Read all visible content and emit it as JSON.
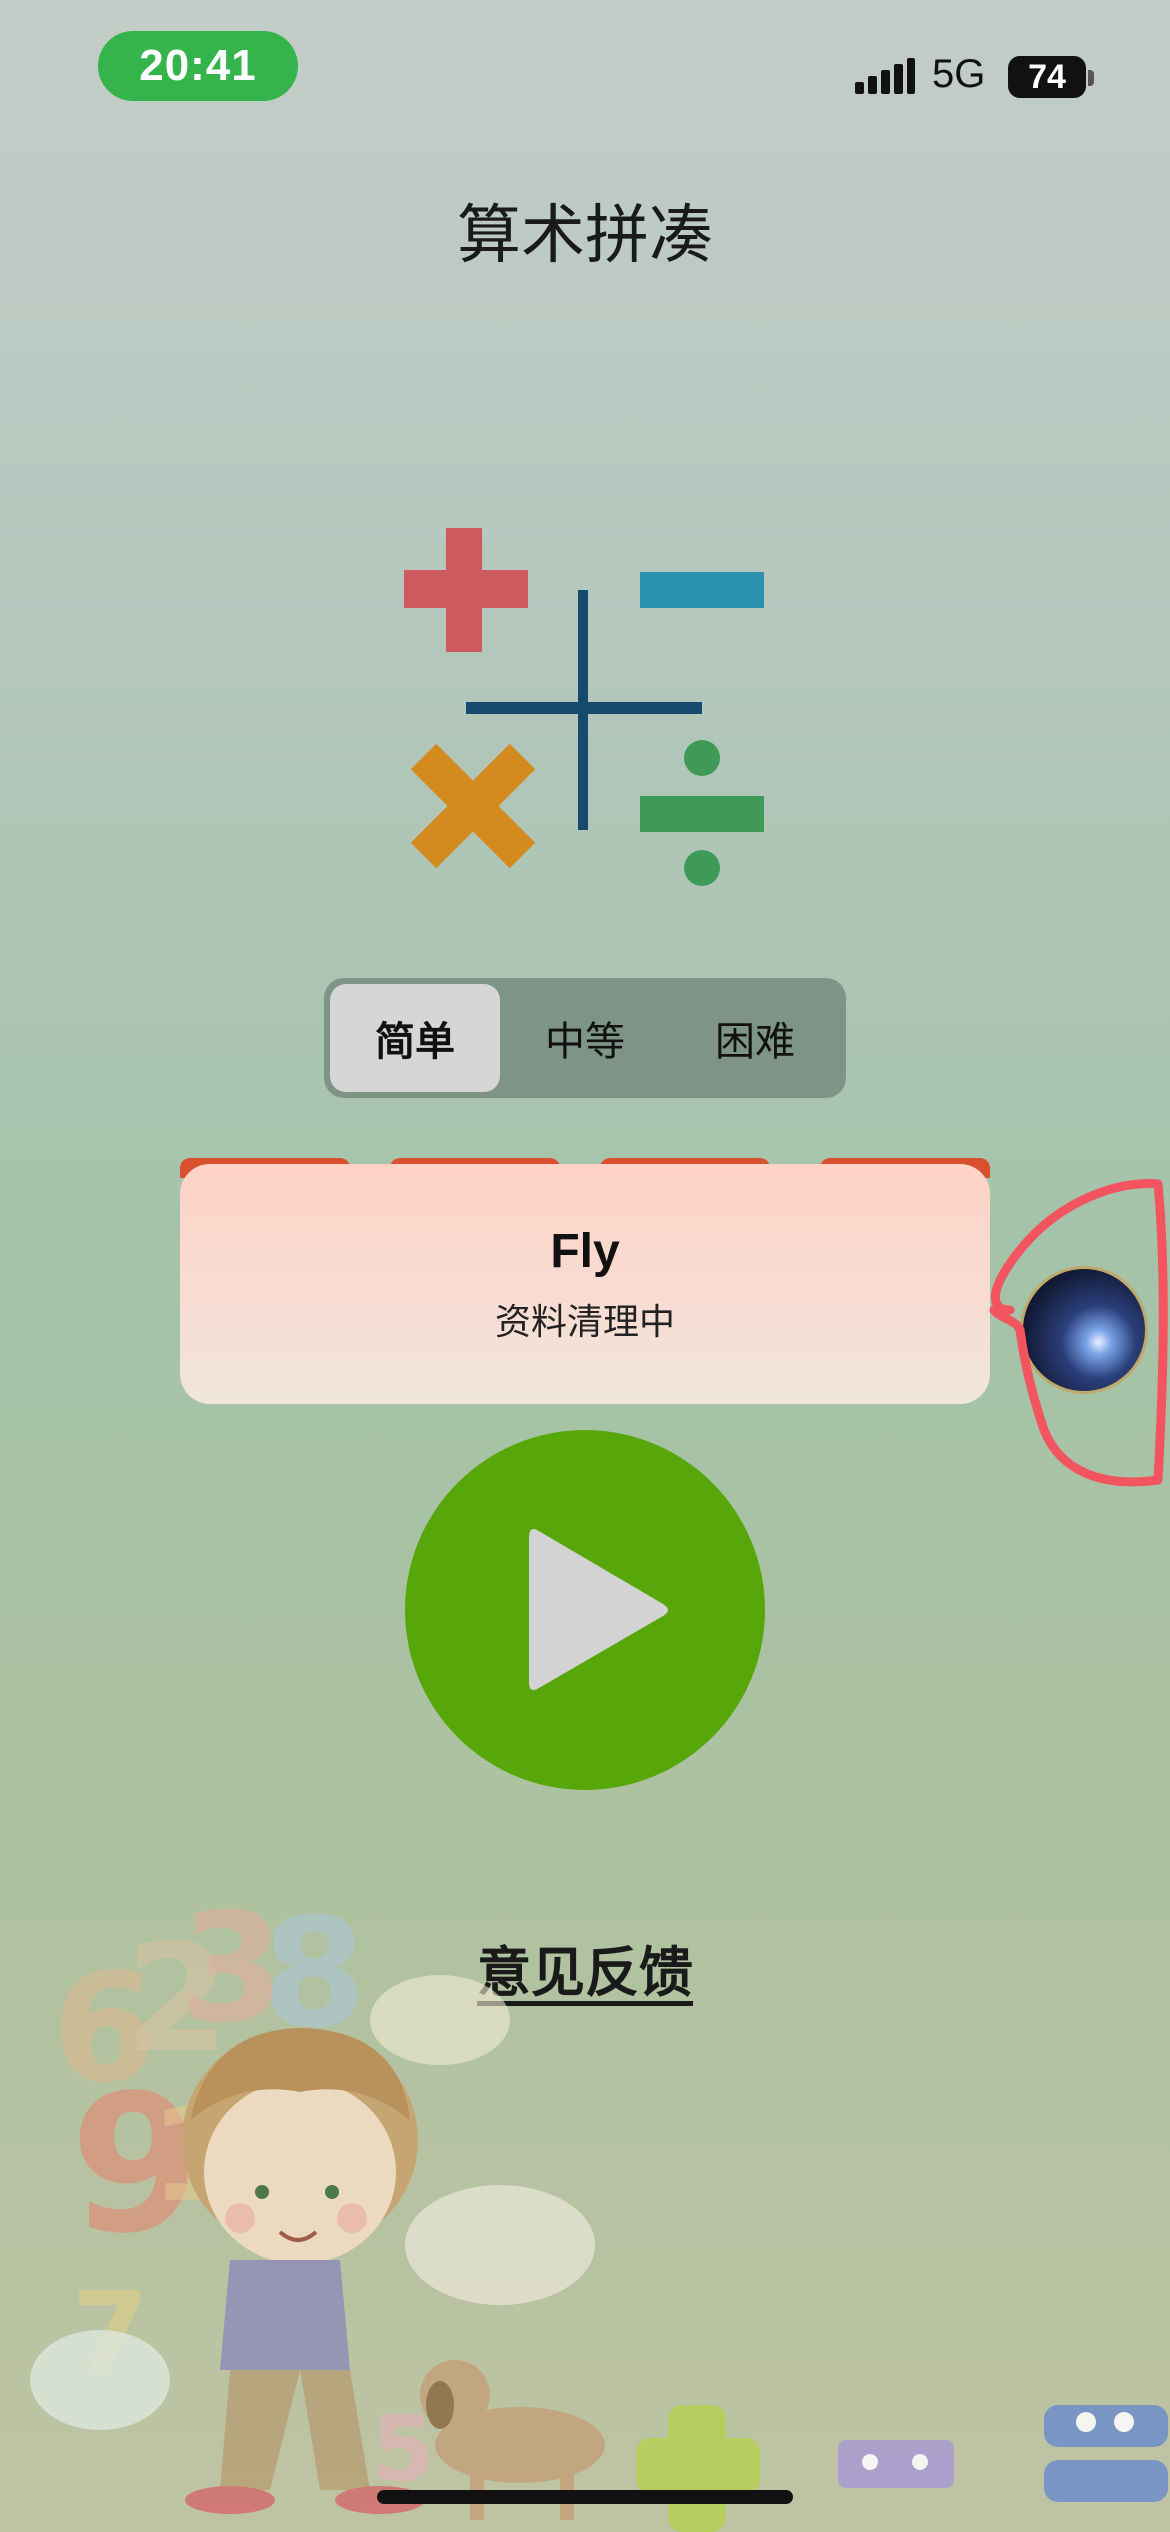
{
  "status_bar": {
    "time": "20:41",
    "network": "5G",
    "battery": "74"
  },
  "title": "算术拼凑",
  "difficulty": {
    "options": [
      "简单",
      "中等",
      "困难"
    ],
    "selected": "简单"
  },
  "notification": {
    "title": "Fly",
    "subtitle": "资料清理中"
  },
  "play_icon": "play-icon",
  "feedback_label": "意见反馈",
  "colors": {
    "time_pill": "#34b44a",
    "plus": "#cf5a5d",
    "minus": "#2b92ad",
    "times": "#d38b1f",
    "divide": "#3f9a58",
    "cross": "#174b6e",
    "play": "#58a70a",
    "annotation": "#f2555f"
  }
}
